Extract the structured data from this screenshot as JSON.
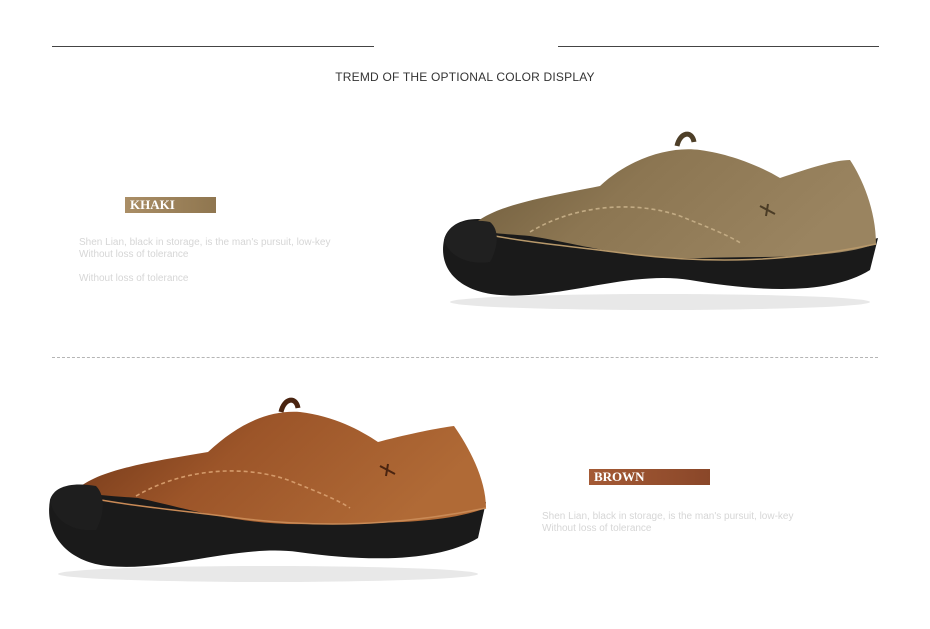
{
  "header": {
    "title": "TREMD OF THE OPTIONAL COLOR DISPLAY"
  },
  "products": [
    {
      "color_label": "KHAKI",
      "description": [
        "Shen Lian, black in storage, is the man's pursuit, low-key",
        "Without loss of tolerance",
        "Without loss of tolerance"
      ],
      "image_icon": "khaki-loafer-image",
      "colors": {
        "tag": "#9c8159",
        "leather": "#8a7450"
      }
    },
    {
      "color_label": "BROWN",
      "description": [
        "Shen Lian, black in storage, is the man's pursuit, low-key",
        "Without loss of tolerance"
      ],
      "image_icon": "brown-loafer-image",
      "colors": {
        "tag": "#98502f",
        "leather": "#a05a2c"
      }
    }
  ]
}
